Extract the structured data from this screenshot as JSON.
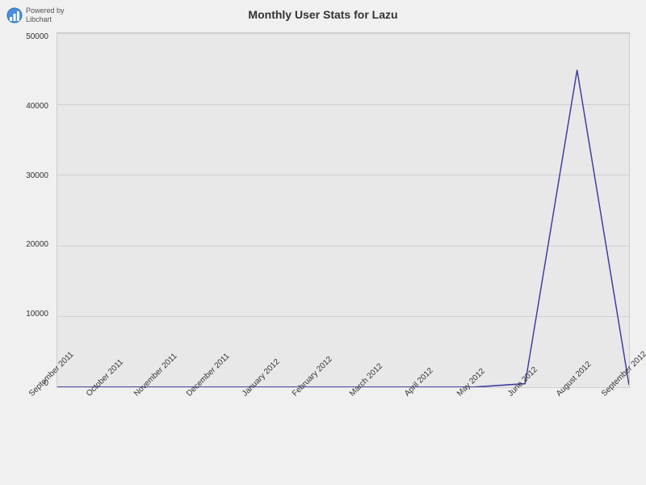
{
  "chart": {
    "title_prefix": "Monthly User Stats for",
    "title_app": "Lazu",
    "title_full": "Monthly User Stats for Lazu",
    "y_axis": {
      "max": 50000,
      "labels": [
        "50000",
        "40000",
        "30000",
        "20000",
        "10000",
        "0"
      ]
    },
    "x_axis": {
      "labels": [
        "September 2011",
        "October 2011",
        "November 2011",
        "December 2011",
        "January 2012",
        "February 2012",
        "March 2012",
        "April 2012",
        "May 2012",
        "June 2012",
        "August 2012",
        "September 2012"
      ]
    },
    "data_points": [
      {
        "month": "September 2011",
        "value": 0
      },
      {
        "month": "October 2011",
        "value": 0
      },
      {
        "month": "November 2011",
        "value": 0
      },
      {
        "month": "December 2011",
        "value": 0
      },
      {
        "month": "January 2012",
        "value": 0
      },
      {
        "month": "February 2012",
        "value": 0
      },
      {
        "month": "March 2012",
        "value": 0
      },
      {
        "month": "April 2012",
        "value": 0
      },
      {
        "month": "May 2012",
        "value": 0
      },
      {
        "month": "June 2012",
        "value": 500
      },
      {
        "month": "August 2012",
        "value": 44800
      },
      {
        "month": "September 2012",
        "value": 300
      }
    ],
    "line_color": "#4040a0",
    "background_color": "#e8e8e8"
  },
  "logo": {
    "powered_by": "Powered by",
    "libchart": "Libchart"
  }
}
